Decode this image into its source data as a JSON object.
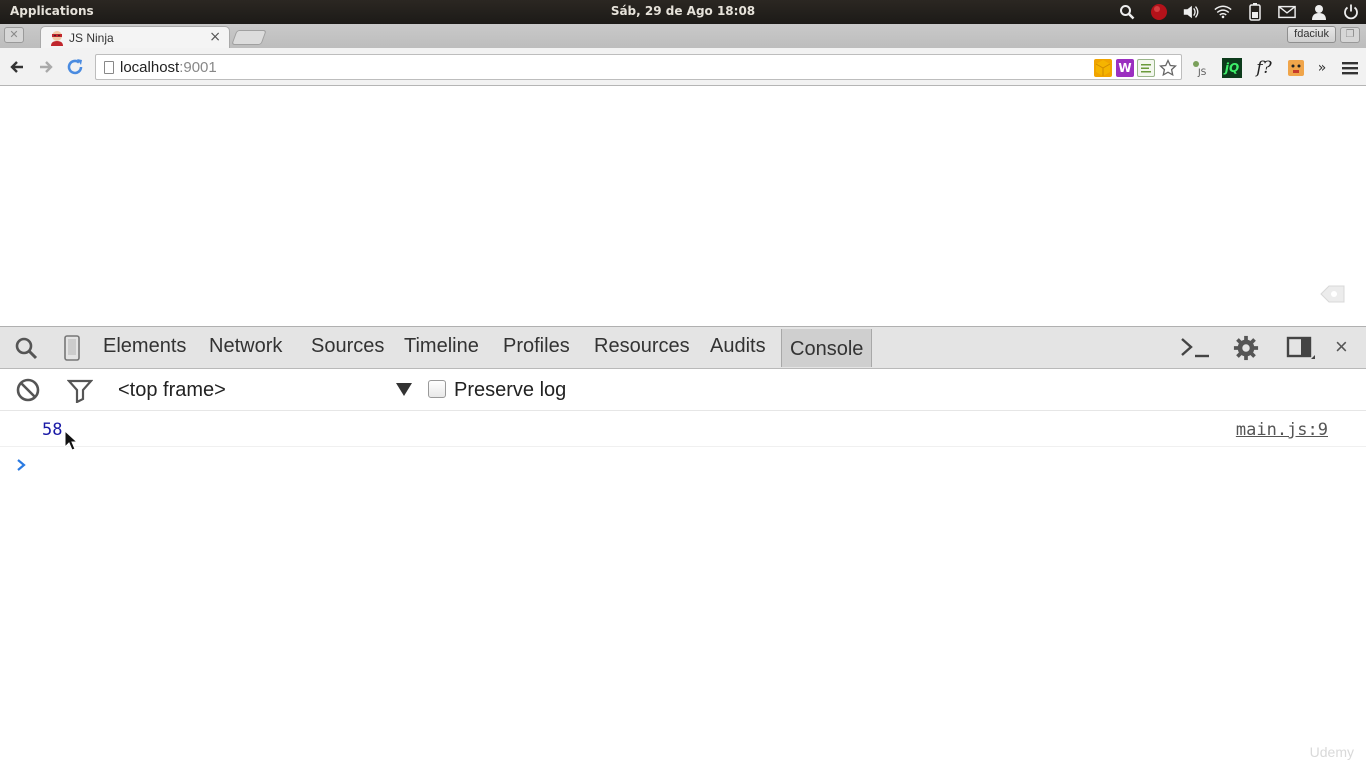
{
  "os_panel": {
    "applications_label": "Applications",
    "clock": "Sáb, 29 de Ago 18:08",
    "tray_icons": [
      "search-icon",
      "record-icon",
      "volume-icon",
      "wifi-icon",
      "battery-icon",
      "mail-icon",
      "user-icon",
      "power-icon"
    ]
  },
  "browser": {
    "tab": {
      "title": "JS Ninja",
      "close_glyph": "×"
    },
    "user_badge": "fdaciuk",
    "url_host": "localhost",
    "url_port": ":9001",
    "extensions": [
      "package-icon",
      "w-icon",
      "rss-icon",
      "bookmark-star-icon",
      "js-icon",
      "jq-icon",
      "fx-icon",
      "face-icon",
      "overflow-icon",
      "menu-icon"
    ]
  },
  "devtools": {
    "tabs": [
      "Elements",
      "Network",
      "Sources",
      "Timeline",
      "Profiles",
      "Resources",
      "Audits",
      "Console"
    ],
    "active_tab": "Console",
    "close_glyph": "×",
    "filter": {
      "frame": "<top frame>",
      "preserve_log_label": "Preserve log",
      "preserve_log_checked": false
    },
    "console": {
      "messages": [
        {
          "value": "58",
          "source": "main.js:9"
        }
      ],
      "prompt_glyph": "›"
    }
  },
  "watermark": "Udemy",
  "colors": {
    "console_number": "#1a1aa6",
    "prompt_blue": "#2a7ae2"
  }
}
